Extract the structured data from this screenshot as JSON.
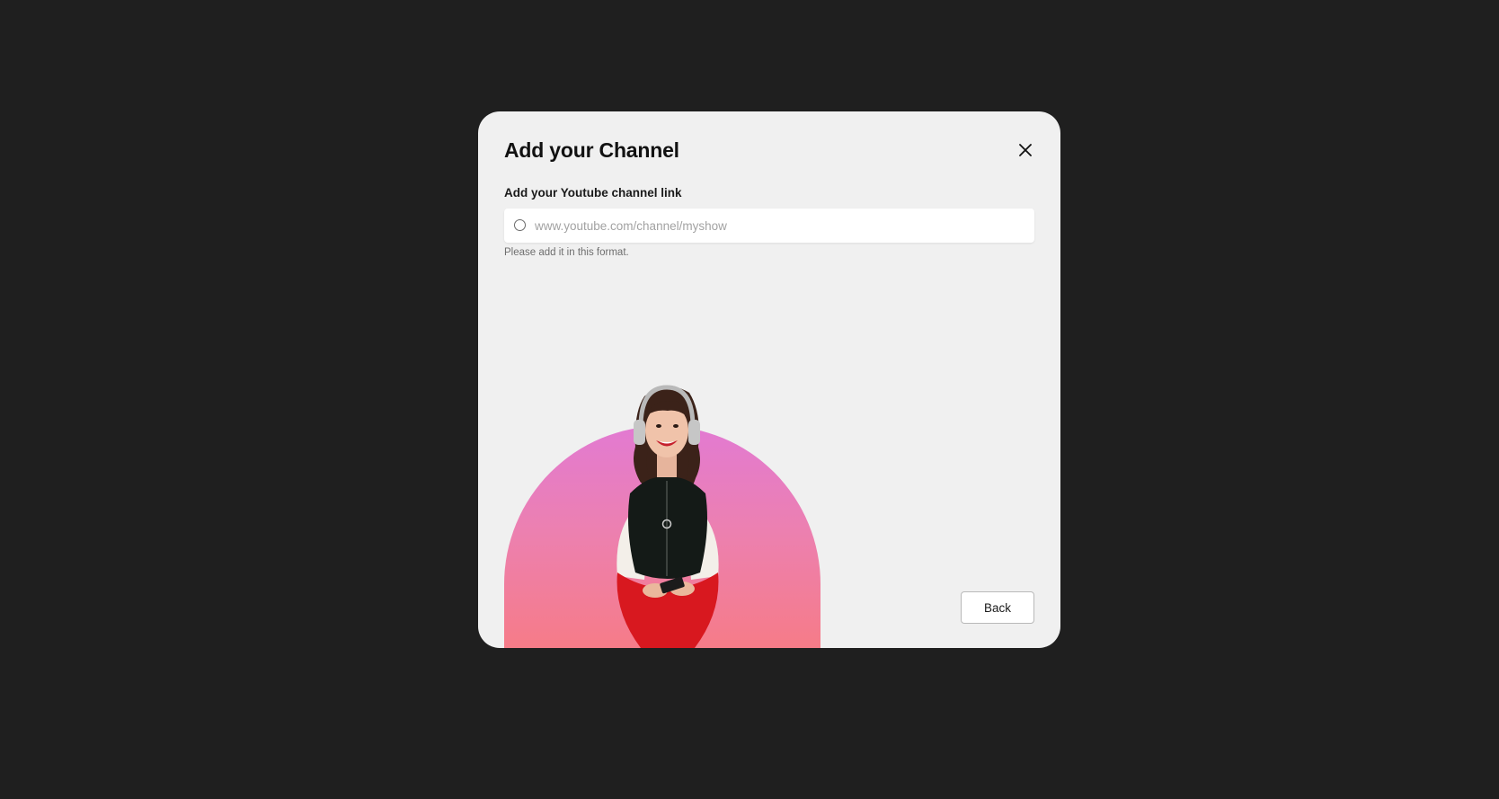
{
  "modal": {
    "title": "Add your Channel",
    "close_icon": "close-icon",
    "field": {
      "label": "Add your Youtube channel link",
      "value": "",
      "placeholder": "www.youtube.com/channel/myshow",
      "icon": "circle-outline-icon",
      "helper": "Please add it in this format."
    },
    "illustration": {
      "gradient_top": "#e27ad2",
      "gradient_bottom": "#f77b84"
    },
    "back_label": "Back"
  },
  "colors": {
    "backdrop": "#1f1f1f",
    "modal_bg": "#f0f0f0"
  }
}
